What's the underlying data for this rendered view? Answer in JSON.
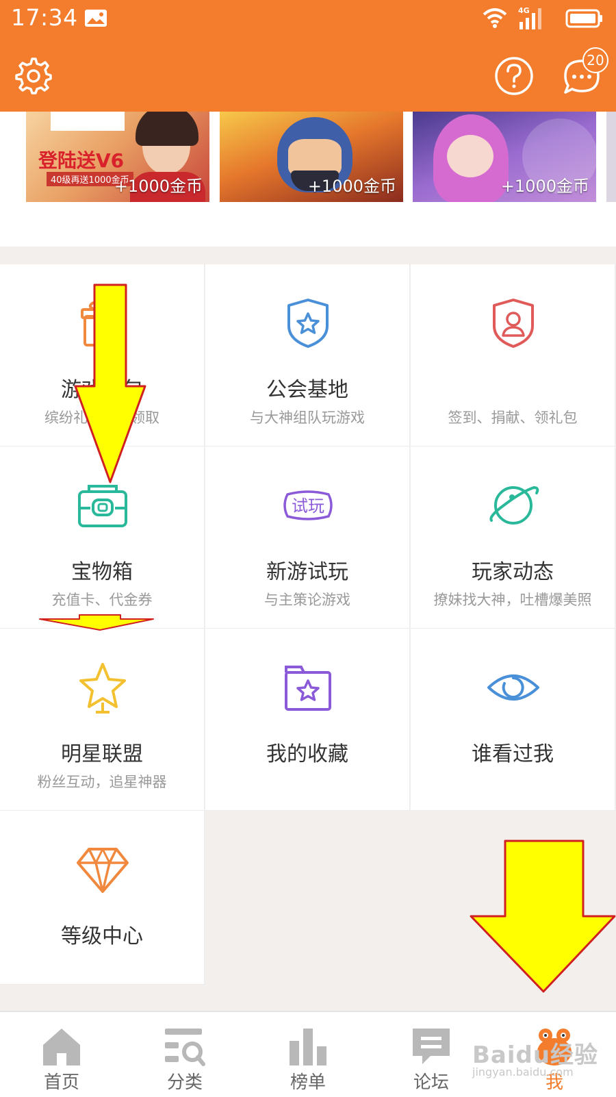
{
  "status_bar": {
    "time": "17:34"
  },
  "header": {
    "message_badge": "20"
  },
  "banners": [
    {
      "headline": "登陆送V6",
      "subline": "40级再送1000金币",
      "reward": "+1000金币"
    },
    {
      "reward": "+1000金币"
    },
    {
      "reward": "+1000金币"
    }
  ],
  "grid": [
    {
      "title": "游戏礼包",
      "subtitle": "缤纷礼包任你领取",
      "icon": "gift-icon",
      "color": "#f0883e"
    },
    {
      "title": "公会基地",
      "subtitle": "与大神组队玩游戏",
      "icon": "shield-star-icon",
      "color": "#4a90d9"
    },
    {
      "title": "",
      "subtitle": "签到、捐献、领礼包",
      "icon": "shield-user-icon",
      "color": "#e05a5a"
    },
    {
      "title": "宝物箱",
      "subtitle": "充值卡、代金券",
      "icon": "treasure-box-icon",
      "color": "#2ab89b"
    },
    {
      "title": "新游试玩",
      "subtitle": "与主策论游戏",
      "icon": "trial-play-icon",
      "color": "#8a5ad8"
    },
    {
      "title": "玩家动态",
      "subtitle": "撩妹找大神，吐槽爆美照",
      "icon": "planet-icon",
      "color": "#2ab89b"
    },
    {
      "title": "明星联盟",
      "subtitle": "粉丝互动，追星神器",
      "icon": "star-icon",
      "color": "#f3c12f"
    },
    {
      "title": "我的收藏",
      "subtitle": "",
      "icon": "favorite-folder-icon",
      "color": "#8a5ad8"
    },
    {
      "title": "谁看过我",
      "subtitle": "",
      "icon": "eye-icon",
      "color": "#4a90d9"
    },
    {
      "title": "等级中心",
      "subtitle": "",
      "icon": "diamond-icon",
      "color": "#f0883e"
    }
  ],
  "bottom_nav": [
    {
      "label": "首页",
      "icon": "home-icon"
    },
    {
      "label": "分类",
      "icon": "category-icon"
    },
    {
      "label": "榜单",
      "icon": "ranking-icon"
    },
    {
      "label": "论坛",
      "icon": "forum-icon"
    },
    {
      "label": "我",
      "icon": "me-icon"
    }
  ],
  "watermark": {
    "brand": "Baidu经验",
    "url": "jingyan.baidu.com"
  },
  "colors": {
    "accent": "#f37d2d",
    "arrow": "#ffff00",
    "arrow_outline": "#d02020"
  }
}
